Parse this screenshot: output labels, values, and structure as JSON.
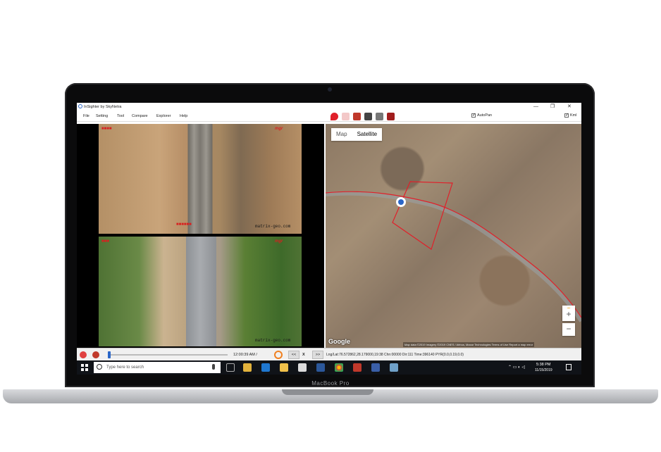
{
  "app": {
    "title": "InSighter by SkyNetra",
    "window_controls": [
      "—",
      "❐",
      "✕"
    ]
  },
  "menu": {
    "items": [
      "File",
      "Setting",
      "Tool",
      "Compare",
      "Explorer",
      "Help"
    ]
  },
  "toolbar": {
    "tools": [
      "map-pin-icon",
      "path-icon",
      "export-icon",
      "save-icon",
      "tag-icon",
      "camera-icon"
    ],
    "autopan_label": "AutoPan",
    "kml_label": "Kml"
  },
  "video": {
    "top_watermark": "matrix-geo.com",
    "bottom_watermark": "matrix-geo.com"
  },
  "map": {
    "mode_map": "Map",
    "mode_satellite": "Satellite",
    "zoom_in": "+",
    "zoom_out": "−",
    "google": "Google",
    "attribution": "Map data ©2019 Imagery ©2019 CNES / Airbus, Maxar Technologies   Terms of Use   Report a map error",
    "route_color": "#e0202a",
    "marker_color": "#2a66c8"
  },
  "playback": {
    "time": "12:00:39 AM /",
    "back_label": "<<",
    "close_label": "X",
    "forward_label": ">>",
    "status": "Lng/Lat:76.572862,28.179000,19:38 Chn:00000 Dir:111 Time:396140 PYR(0.0,0.19,0.0)"
  },
  "taskbar": {
    "search_placeholder": "Type here to search",
    "time": "5:38 PM",
    "date": "11/15/2019"
  }
}
